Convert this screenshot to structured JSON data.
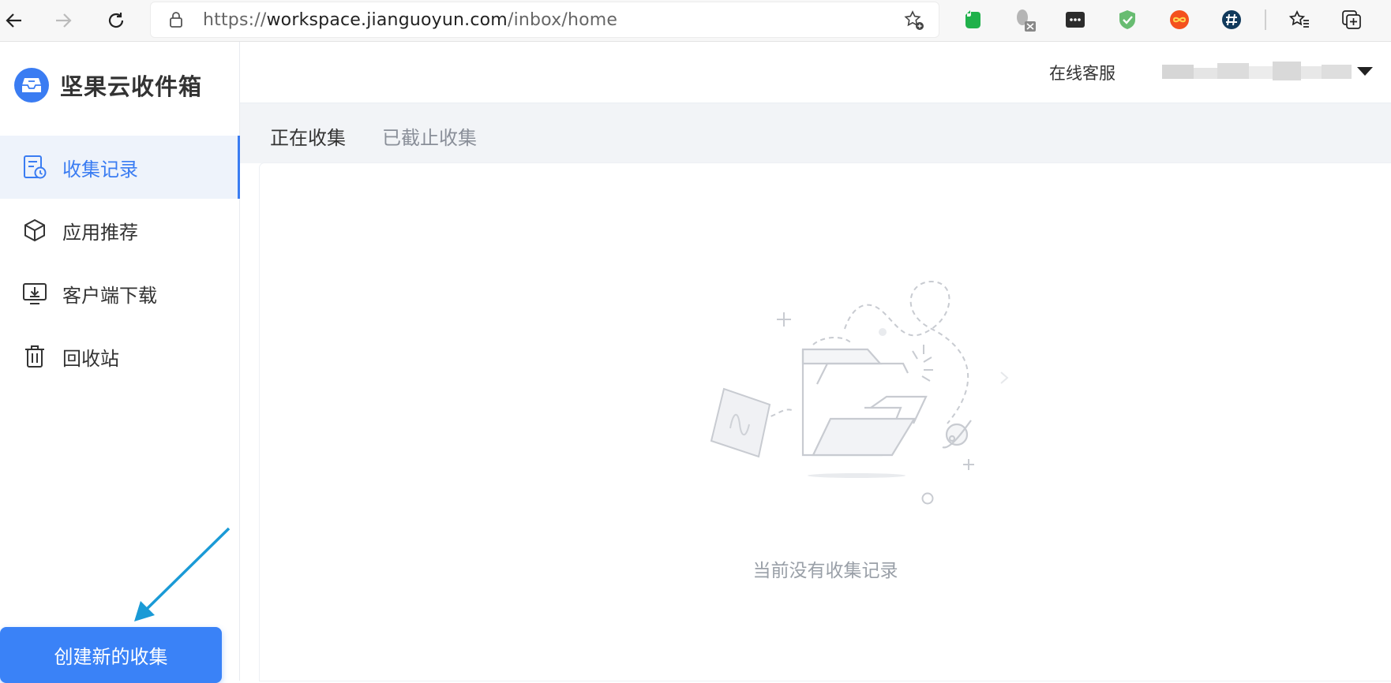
{
  "browser": {
    "url_prefix": "https://",
    "url_host": "workspace.jianguoyun.com",
    "url_path": "/inbox/home",
    "icons": [
      "back-icon",
      "forward-icon",
      "reload-icon",
      "lock-icon",
      "favorite-add-icon",
      "evernote-icon",
      "extension-x-icon",
      "password-manager-icon",
      "adguard-shield-icon",
      "infinity-icon",
      "hashtag-icon",
      "favorites-icon",
      "collections-icon"
    ]
  },
  "brand": {
    "name": "坚果云收件箱",
    "color": "#3a7cf2"
  },
  "sidebar": {
    "items": [
      {
        "label": "收集记录",
        "icon": "record-icon",
        "active": true
      },
      {
        "label": "应用推荐",
        "icon": "cube-icon",
        "active": false
      },
      {
        "label": "客户端下载",
        "icon": "download-icon",
        "active": false
      },
      {
        "label": "回收站",
        "icon": "trash-icon",
        "active": false
      }
    ],
    "create_button": "创建新的收集"
  },
  "header": {
    "support": "在线客服"
  },
  "tabs": [
    {
      "label": "正在收集",
      "active": true
    },
    {
      "label": "已截止收集",
      "active": false
    }
  ],
  "main": {
    "empty_message": "当前没有收集记录"
  }
}
